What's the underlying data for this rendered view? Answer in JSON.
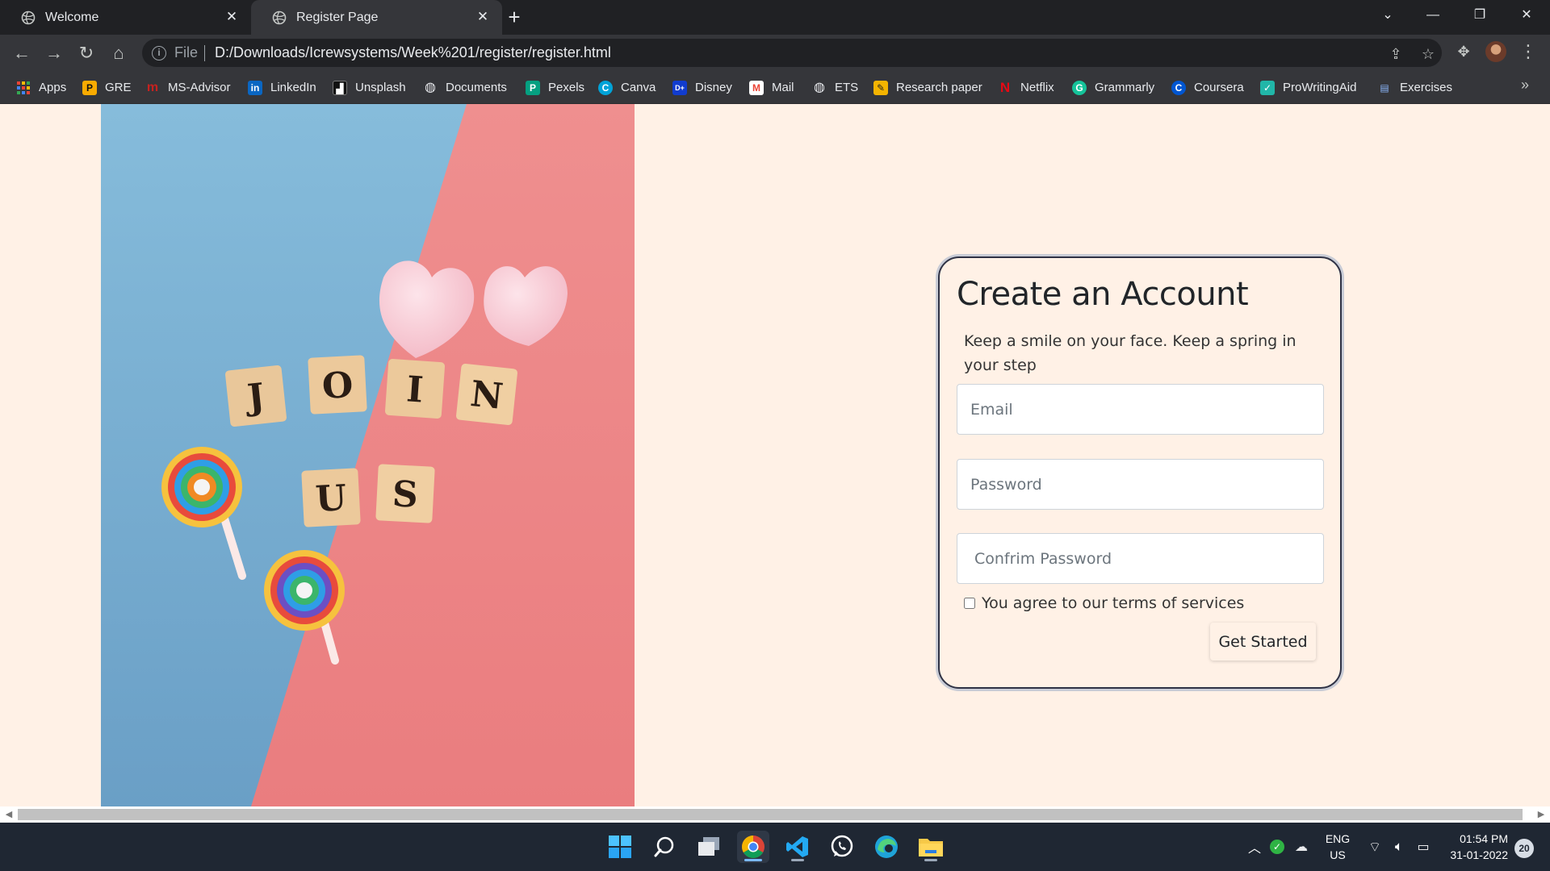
{
  "browser": {
    "tabs": [
      {
        "title": "Welcome",
        "active": false
      },
      {
        "title": "Register Page",
        "active": true
      }
    ],
    "address": {
      "scheme": "File",
      "url": "D:/Downloads/Icrewsystems/Week%201/register/register.html"
    },
    "bookmarks": [
      {
        "label": "Apps",
        "icon": "apps-grid-icon",
        "color": "#ea4335"
      },
      {
        "label": "GRE",
        "icon": "gre-icon",
        "color": "#f9ab00"
      },
      {
        "label": "MS-Advisor",
        "icon": "ms-advisor-icon",
        "color": "#c5221f"
      },
      {
        "label": "LinkedIn",
        "icon": "linkedin-icon",
        "color": "#0a66c2"
      },
      {
        "label": "Unsplash",
        "icon": "unsplash-icon",
        "color": "#111111"
      },
      {
        "label": "Documents",
        "icon": "globe-icon",
        "color": "#5f6368"
      },
      {
        "label": "Pexels",
        "icon": "pexels-icon",
        "color": "#05a081"
      },
      {
        "label": "Canva",
        "icon": "canva-icon",
        "color": "#00c4cc"
      },
      {
        "label": "Disney",
        "icon": "disney-icon",
        "color": "#113ccf"
      },
      {
        "label": "Mail",
        "icon": "gmail-icon",
        "color": "#ea4335"
      },
      {
        "label": "ETS",
        "icon": "globe-icon",
        "color": "#5f6368"
      },
      {
        "label": "Research paper",
        "icon": "research-icon",
        "color": "#f4b400"
      },
      {
        "label": "Netflix",
        "icon": "netflix-icon",
        "color": "#e50914"
      },
      {
        "label": "Grammarly",
        "icon": "grammarly-icon",
        "color": "#15c39a"
      },
      {
        "label": "Coursera",
        "icon": "coursera-icon",
        "color": "#0056d2"
      },
      {
        "label": "ProWritingAid",
        "icon": "prowritingaid-icon",
        "color": "#21b6a8"
      },
      {
        "label": "Exercises",
        "icon": "exercises-icon",
        "color": "#4285f4"
      }
    ]
  },
  "page": {
    "heading": "Create an Account",
    "tagline": "Keep a smile on your face. Keep a spring in your step",
    "email_placeholder": "Email",
    "password_placeholder": "Password",
    "confirm_placeholder": "Confrim Password",
    "terms_label": "You agree to our terms of services",
    "submit_label": "Get Started",
    "hero_letters": [
      "J",
      "O",
      "I",
      "N",
      "U",
      "S"
    ],
    "colors": {
      "background": "#fff1e6",
      "blue": "#7fb0d4",
      "pink": "#ee8587"
    }
  },
  "taskbar": {
    "apps": [
      "windows-start-icon",
      "search-icon",
      "task-view-icon",
      "chrome-icon",
      "vscode-icon",
      "whatsapp-icon",
      "edge-icon",
      "file-explorer-icon"
    ],
    "language_top": "ENG",
    "language_bottom": "US",
    "time": "01:54 PM",
    "date": "31-01-2022",
    "notifications": "20"
  }
}
